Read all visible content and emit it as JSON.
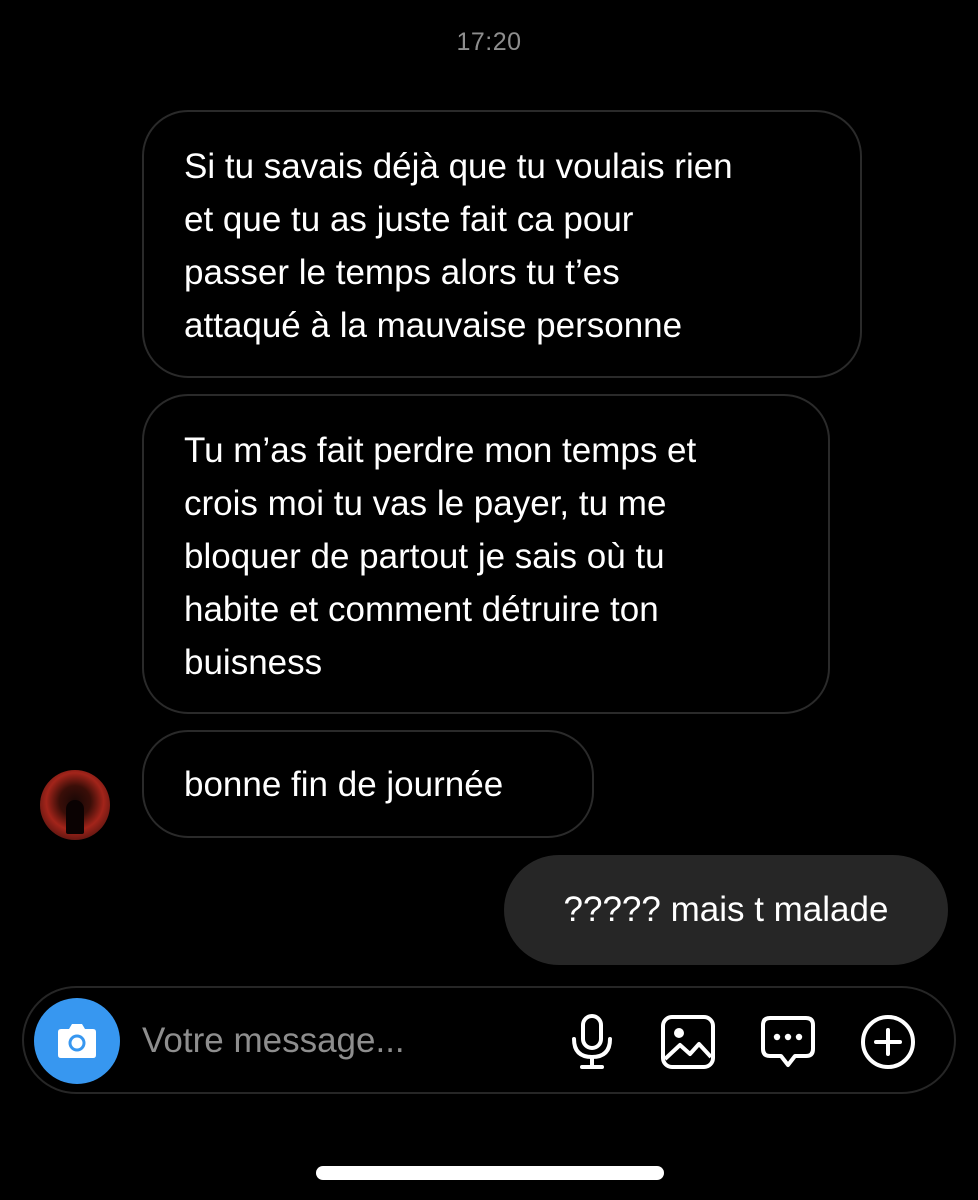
{
  "timestamp": "17:20",
  "messages": [
    {
      "direction": "incoming",
      "text": "Si tu savais déjà que tu voulais rien\net que tu as juste fait ca pour\npasser le temps alors tu t’es\nattaqué à la mauvaise personne"
    },
    {
      "direction": "incoming",
      "text": "Tu m’as fait perdre mon temps et\ncrois moi tu vas le payer, tu me\nbloquer de partout je sais où tu\nhabite et comment détruire ton\nbuisness"
    },
    {
      "direction": "incoming",
      "text": "bonne fin de journée"
    },
    {
      "direction": "outgoing",
      "text": "????? mais t malade"
    }
  ],
  "composer": {
    "placeholder": "Votre message...",
    "value": "",
    "icons": [
      "camera-icon",
      "microphone-icon",
      "image-icon",
      "sticker-icon",
      "plus-circle-icon"
    ]
  },
  "colors": {
    "background": "#000000",
    "incoming_border": "#2a2a2a",
    "outgoing_bubble": "#262626",
    "camera_button": "#3797f0",
    "muted_text": "#8e8e8e"
  }
}
